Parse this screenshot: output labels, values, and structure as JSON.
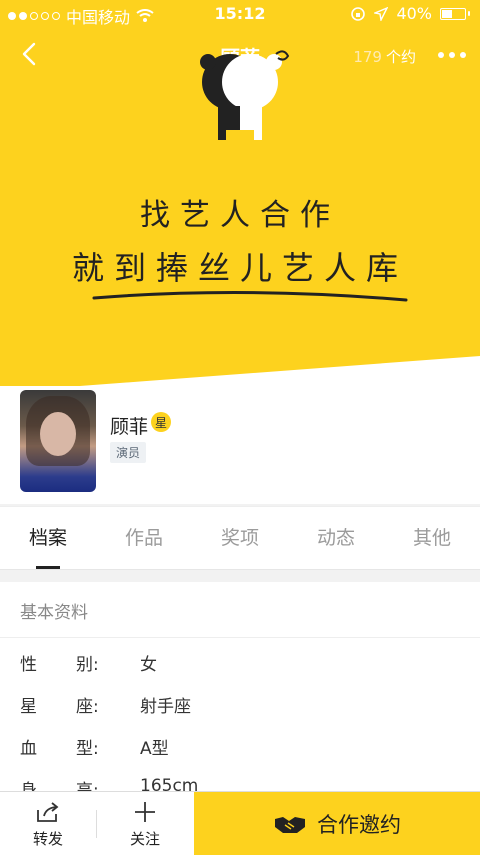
{
  "status": {
    "carrier": "中国移动",
    "time": "15:12",
    "battery": "40%"
  },
  "header": {
    "title": "顾菲",
    "count_num": "179",
    "count_label": "个约"
  },
  "banner": {
    "slogan_line1": "找艺人合作",
    "slogan_line2": "就到捧丝儿艺人库"
  },
  "profile": {
    "name": "顾菲",
    "badge": "星",
    "role": "演员"
  },
  "tabs": [
    {
      "label": "档案",
      "active": true
    },
    {
      "label": "作品"
    },
    {
      "label": "奖项"
    },
    {
      "label": "动态"
    },
    {
      "label": "其他"
    }
  ],
  "basic_info": {
    "title": "基本资料",
    "rows": [
      {
        "k1": "性",
        "k2": "别:",
        "value": "女"
      },
      {
        "k1": "星",
        "k2": "座:",
        "value": "射手座"
      },
      {
        "k1": "血",
        "k2": "型:",
        "value": "A型"
      },
      {
        "k1": "身",
        "k2": "高:",
        "value": "165cm"
      }
    ]
  },
  "bottom_bar": {
    "share_label": "转发",
    "follow_label": "关注",
    "cta_label": "合作邀约"
  },
  "colors": {
    "accent": "#fdd21e"
  }
}
